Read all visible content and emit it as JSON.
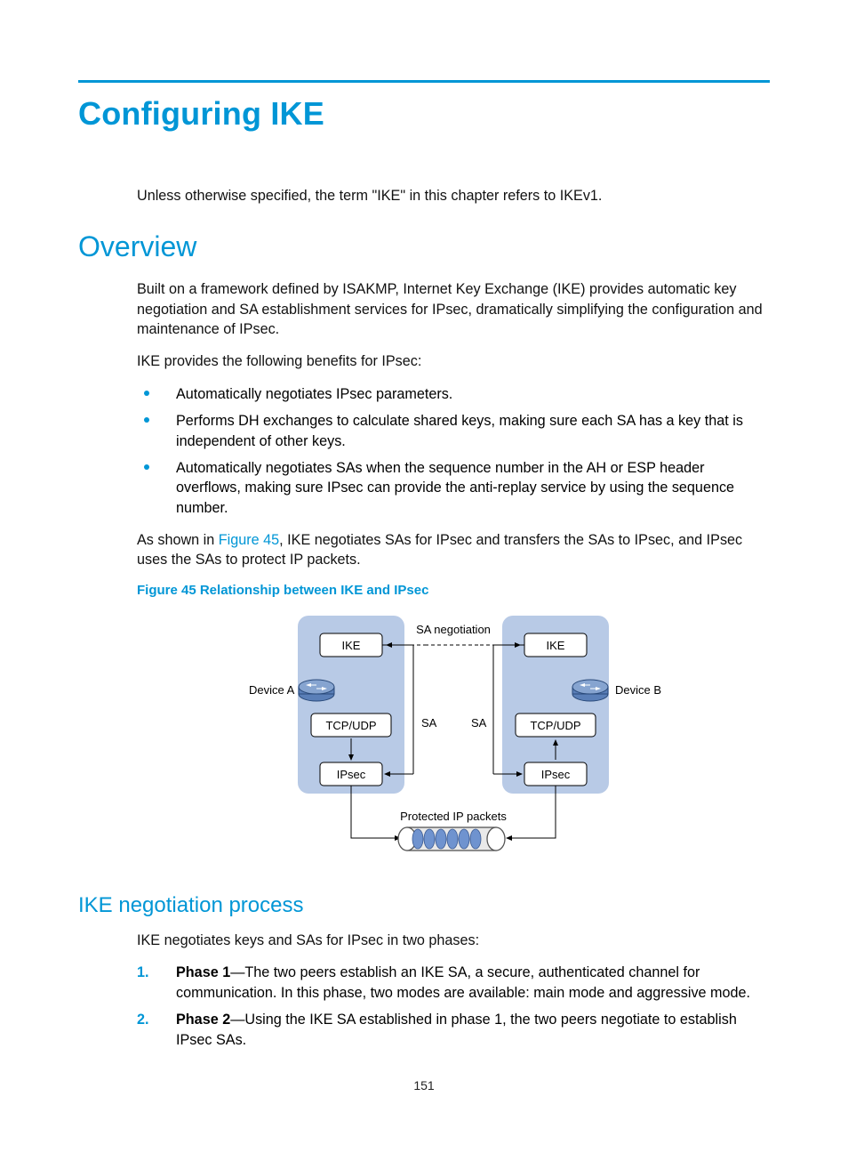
{
  "title": "Configuring IKE",
  "intro": "Unless otherwise specified, the term \"IKE\" in this chapter refers to IKEv1.",
  "sections": {
    "overview": {
      "heading": "Overview",
      "p1": "Built on a framework defined by ISAKMP, Internet Key Exchange (IKE) provides automatic key negotiation and SA establishment services for IPsec, dramatically simplifying the configuration and maintenance of IPsec.",
      "p2": "IKE provides the following benefits for IPsec:",
      "bullets": [
        "Automatically negotiates IPsec parameters.",
        "Performs DH exchanges to calculate shared keys, making sure each SA has a key that is independent of other keys.",
        "Automatically negotiates SAs when the sequence number in the AH or ESP header overflows, making sure IPsec can provide the anti-replay service by using the sequence number."
      ],
      "p3_pre": "As shown in ",
      "p3_link": "Figure 45",
      "p3_post": ", IKE negotiates SAs for IPsec and transfers the SAs to IPsec, and IPsec uses the SAs to protect IP packets.",
      "figure_caption": "Figure 45 Relationship between IKE and IPsec"
    },
    "negotiation": {
      "heading": "IKE negotiation process",
      "intro": "IKE negotiates keys and SAs for IPsec in two phases:",
      "items": [
        {
          "num": "1.",
          "label": "Phase 1",
          "text": "—The two peers establish an IKE SA, a secure, authenticated channel for communication. In this phase, two modes are available: main mode and aggressive mode."
        },
        {
          "num": "2.",
          "label": "Phase 2",
          "text": "—Using the IKE SA established in phase 1, the two peers negotiate to establish IPsec SAs."
        }
      ]
    }
  },
  "figure": {
    "sa_negotiation": "SA negotiation",
    "ike": "IKE",
    "tcp_udp": "TCP/UDP",
    "ipsec": "IPsec",
    "sa": "SA",
    "device_a": "Device A",
    "device_b": "Device B",
    "protected": "Protected IP packets"
  },
  "page_number": "151"
}
